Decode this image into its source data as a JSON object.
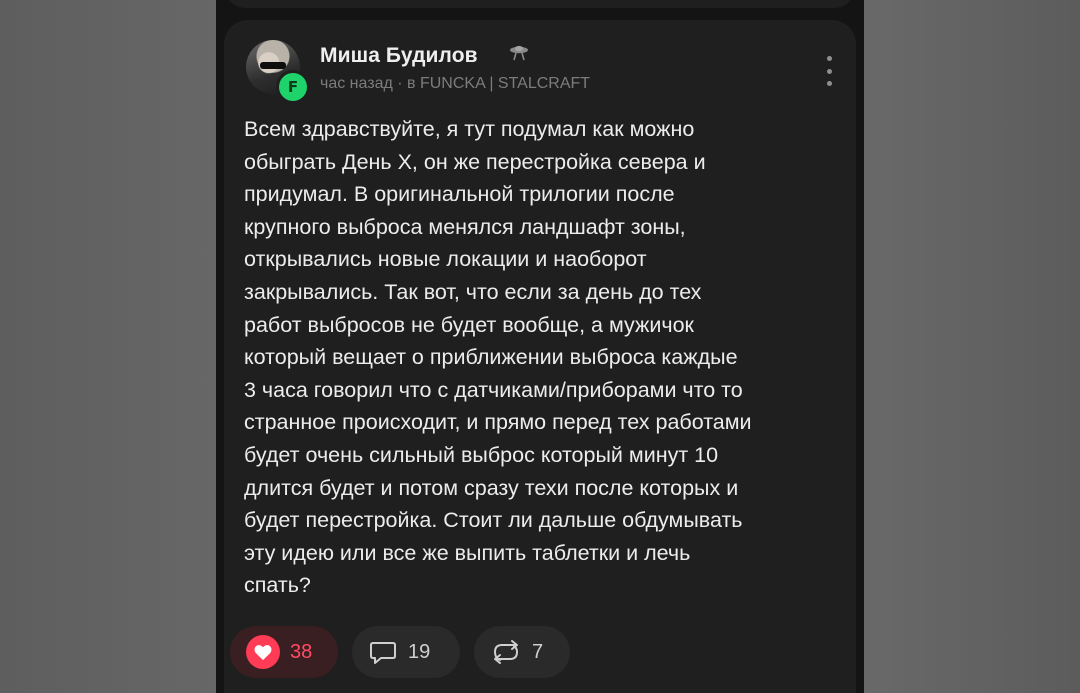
{
  "post": {
    "author": {
      "name": "Миша Будилов",
      "avatar_badge_letter": "F",
      "badge_icon": "ufo-icon"
    },
    "meta": "час назад · в FUNCKA | STALCRAFT",
    "text": "Всем здравствуйте, я тут подумал как можно\nобыграть День Х, он же перестройка севера и\nпридумал. В оригинальной трилогии после\nкрупного выброса менялся ландшафт зоны,\nоткрывались новые локации и наоборот\nзакрывались. Так вот, что если за день до тех\nработ выбросов не будет вообще, а мужичок\nкоторый вещает о приближении выброса каждые\n3 часа говорил что с датчиками/приборами что то\nстранное происходит, и прямо перед тех работами\nбудет очень сильный выброс который минут 10\nдлится будет и потом сразу техи после которых и\nбудет перестройка. Стоит ли дальше обдумывать\nэту идею или все же выпить таблетки и лечь\nспать?",
    "actions": {
      "likes": "38",
      "comments": "19",
      "reposts": "7"
    }
  },
  "colors": {
    "like_accent": "#ff3b55",
    "badge_green": "#1fd36b",
    "card_bg": "#1f1f1f",
    "page_bg": "#141414"
  }
}
